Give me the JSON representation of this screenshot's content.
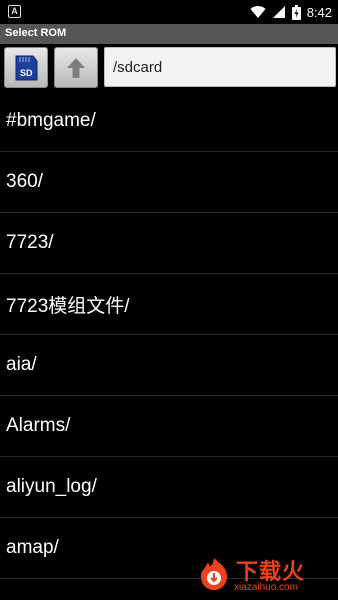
{
  "status_bar": {
    "left_icon": "A",
    "time": "8:42",
    "icons": [
      "wifi-icon",
      "signal-icon",
      "battery-icon"
    ]
  },
  "title_bar": {
    "title": "Select ROM"
  },
  "toolbar": {
    "sdcard_button_icon": "sdcard-icon",
    "up_button_icon": "up-arrow-icon",
    "path_value": "/sdcard"
  },
  "files": [
    {
      "name": "#bmgame/"
    },
    {
      "name": "360/"
    },
    {
      "name": "7723/"
    },
    {
      "name": "7723模组文件/"
    },
    {
      "name": "aia/"
    },
    {
      "name": "Alarms/"
    },
    {
      "name": "aliyun_log/"
    },
    {
      "name": "amap/"
    }
  ],
  "watermark": {
    "title": "下载火",
    "url": "xiazaihuo.com"
  },
  "colors": {
    "title_bar_bg": "#555555",
    "background": "#000000",
    "watermark": "#e8431e"
  }
}
